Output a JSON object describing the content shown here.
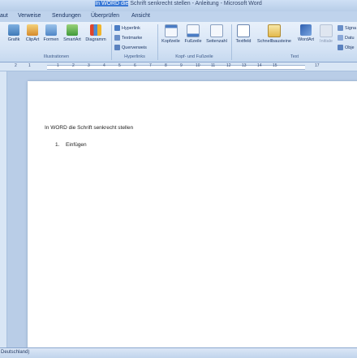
{
  "window": {
    "title_highlight": "In WORD die",
    "title_rest": " Schrift senkrecht stellen - Anleitung - Microsoft Word"
  },
  "tabs": [
    "aut",
    "Verweise",
    "Sendungen",
    "Überprüfen",
    "Ansicht"
  ],
  "ribbon": {
    "illustrationen": {
      "buttons": [
        "Grafik",
        "ClipArt",
        "Formen",
        "SmartArt",
        "Diagramm"
      ],
      "label": "Illustrationen"
    },
    "hyperlinks": {
      "buttons": [
        "Hyperlink",
        "Textmarke",
        "Querverweis"
      ],
      "label": "Hyperlinks"
    },
    "kopf_fusszeile": {
      "buttons": [
        "Kopfzeile",
        "Fußzeile",
        "Seitenzahl"
      ],
      "label": "Kopf- und Fußzeile"
    },
    "text": {
      "buttons": [
        "Textfeld",
        "Schnellbausteine",
        "WordArt",
        "Initiale"
      ],
      "small": [
        "Signa",
        "Datu",
        "Obje"
      ],
      "label": "Text"
    }
  },
  "ruler_numbers": [
    "2",
    "1",
    "1",
    "2",
    "3",
    "4",
    "5",
    "6",
    "7",
    "8",
    "9",
    "10",
    "11",
    "12",
    "13",
    "14",
    "15",
    "17"
  ],
  "document": {
    "heading": "In WORD die Schrift senkrecht stellen",
    "list": [
      {
        "number": "1.",
        "text": "Einfügen"
      }
    ]
  },
  "status": {
    "language": "Deutschland)"
  },
  "colors": {
    "ribbon_bg": "#d3e2f4",
    "title_highlight": "#3a79d6",
    "page": "#ffffff"
  }
}
